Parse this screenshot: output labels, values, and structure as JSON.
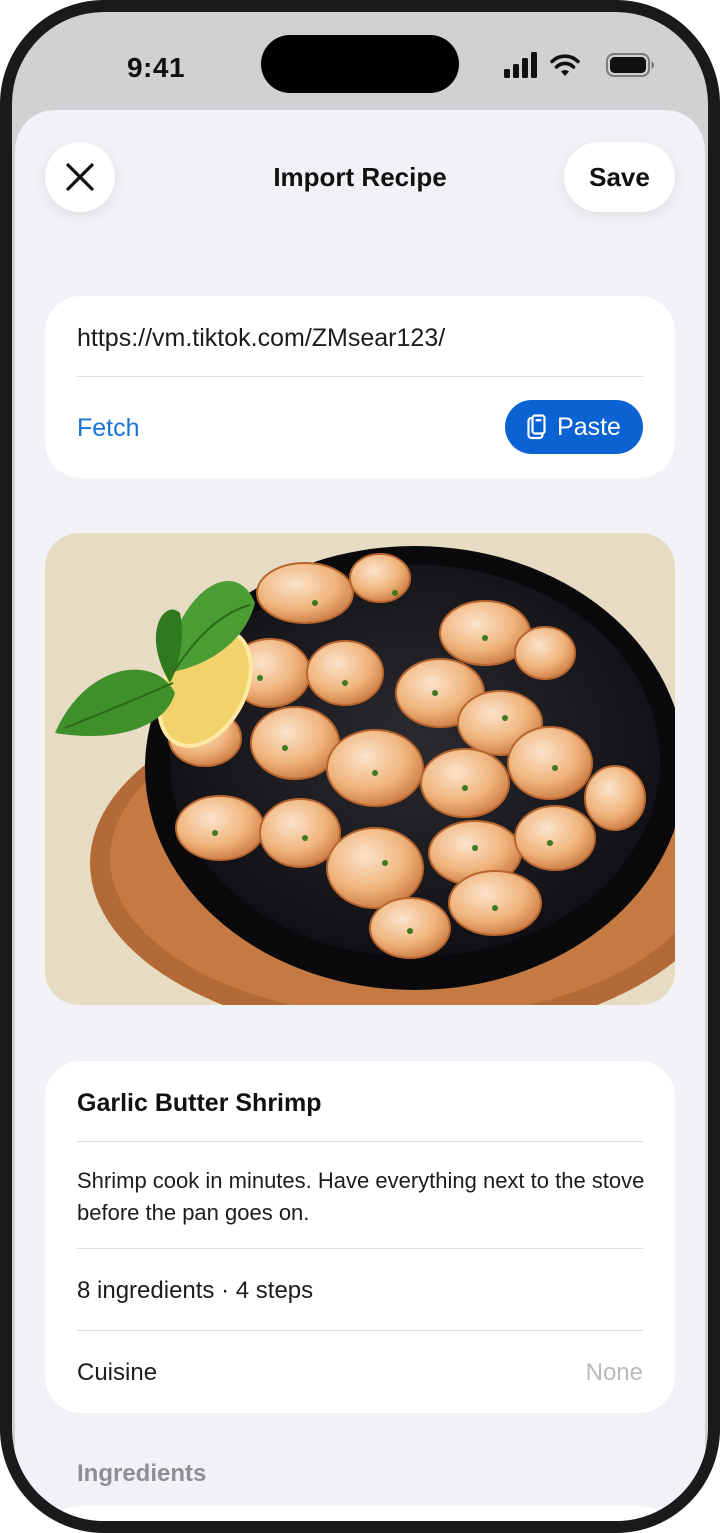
{
  "status_bar": {
    "time": "9:41",
    "icons": [
      "cellular-signal-icon",
      "wifi-icon",
      "battery-icon"
    ]
  },
  "nav": {
    "close_icon": "close-icon",
    "title": "Import Recipe",
    "save_label": "Save"
  },
  "import": {
    "url": "https://vm.tiktok.com/ZMsear123/",
    "fetch_label": "Fetch",
    "paste_label": "Paste",
    "paste_icon": "clipboard-icon"
  },
  "recipe": {
    "title": "Garlic Butter Shrimp",
    "description": "Shrimp cook in minutes. Have everything next to the stove before the pan goes on.",
    "meta": "8 ingredients · 4 steps",
    "cuisine_label": "Cuisine",
    "cuisine_value": "None"
  },
  "sections": {
    "ingredients_header": "Ingredients"
  },
  "colors": {
    "accent": "#0b63d3",
    "link": "#1a73d8",
    "sheet_background": "#f2f2f6",
    "placeholder": "#b9b9be"
  }
}
